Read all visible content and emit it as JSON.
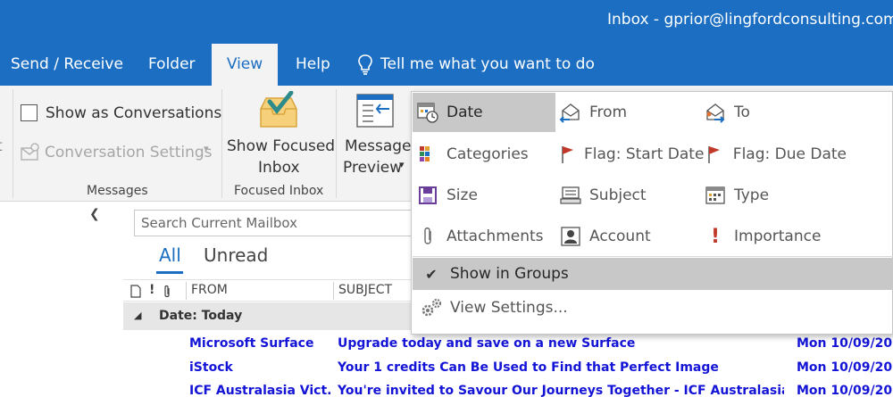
{
  "window": {
    "title": "Inbox - gprior@lingfordconsulting.com.au"
  },
  "tabs": [
    {
      "label": "Send / Receive"
    },
    {
      "label": "Folder"
    },
    {
      "label": "View",
      "active": true
    },
    {
      "label": "Help"
    }
  ],
  "tellme": {
    "label": "Tell me what you want to do"
  },
  "ribbon": {
    "messages": {
      "show_as_conversations": "Show as Conversations",
      "conversation_settings": "Conversation Settings",
      "group_label": "Messages"
    },
    "focused_inbox": {
      "button_line1": "Show Focused",
      "button_line2": "Inbox",
      "group_label": "Focused Inbox"
    },
    "message_preview": {
      "line1": "Message",
      "line2": "Preview"
    }
  },
  "message_list": {
    "search_placeholder": "Search Current Mailbox",
    "filter_all": "All",
    "filter_unread": "Unread",
    "columns": {
      "from": "FROM",
      "subject": "SUBJECT"
    },
    "group_header": "Date: Today",
    "rows": [
      {
        "from": "Microsoft Surface",
        "subject": "Upgrade today and save on a new Surface",
        "date": "Mon 10/09/20"
      },
      {
        "from": "iStock",
        "subject": "Your 1 credits Can Be Used to Find that Perfect Image",
        "date": "Mon 10/09/20"
      },
      {
        "from": "ICF Australasia Vict...",
        "subject": "You're invited to Savour Our Journeys Together - ICF Australasia.....",
        "date": "Mon 10/09/20"
      }
    ]
  },
  "arrange_menu": {
    "items": [
      {
        "label": "Date",
        "icon": "calendar-clock-icon",
        "selected": true
      },
      {
        "label": "From",
        "icon": "envelope-from-icon"
      },
      {
        "label": "To",
        "icon": "envelope-to-icon"
      },
      {
        "label": "Categories",
        "icon": "categories-icon"
      },
      {
        "label": "Flag: Start Date",
        "icon": "flag-icon"
      },
      {
        "label": "Flag: Due Date",
        "icon": "flag-icon"
      },
      {
        "label": "Size",
        "icon": "size-icon"
      },
      {
        "label": "Subject",
        "icon": "subject-icon"
      },
      {
        "label": "Type",
        "icon": "type-icon"
      },
      {
        "label": "Attachments",
        "icon": "paperclip-icon"
      },
      {
        "label": "Account",
        "icon": "account-icon"
      },
      {
        "label": "Importance",
        "icon": "exclamation-icon"
      }
    ],
    "show_in_groups": "Show in Groups",
    "view_settings": "View Settings..."
  },
  "colors": {
    "brand_blue": "#1b6ec2",
    "unread_blue": "#1414d7",
    "flag_red": "#c0392b"
  }
}
